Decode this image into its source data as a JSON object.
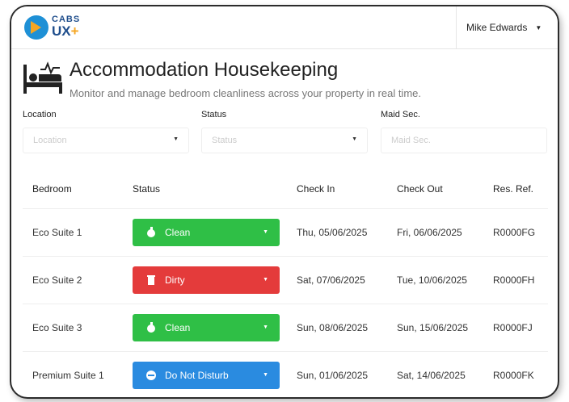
{
  "brand": {
    "top": "CABS",
    "main": "UX",
    "plus": "+"
  },
  "user": {
    "name": "Mike Edwards"
  },
  "page": {
    "title": "Accommodation Housekeeping",
    "subtitle": "Monitor and manage bedroom cleanliness across your property in real time."
  },
  "filters": [
    {
      "label": "Location",
      "placeholder": "Location"
    },
    {
      "label": "Status",
      "placeholder": "Status"
    },
    {
      "label": "Maid Sec.",
      "placeholder": "Maid Sec."
    }
  ],
  "table": {
    "columns": [
      "Bedroom",
      "Status",
      "Check In",
      "Check Out",
      "Res. Ref."
    ],
    "rows": [
      {
        "bedroom": "Eco Suite 1",
        "status": "Clean",
        "check_in": "Thu, 05/06/2025",
        "check_out": "Fri, 06/06/2025",
        "ref": "R0000FG"
      },
      {
        "bedroom": "Eco Suite 2",
        "status": "Dirty",
        "check_in": "Sat, 07/06/2025",
        "check_out": "Tue, 10/06/2025",
        "ref": "R0000FH"
      },
      {
        "bedroom": "Eco Suite 3",
        "status": "Clean",
        "check_in": "Sun, 08/06/2025",
        "check_out": "Sun, 15/06/2025",
        "ref": "R0000FJ"
      },
      {
        "bedroom": "Premium Suite 1",
        "status": "Do Not Disturb",
        "check_in": "Sun, 01/06/2025",
        "check_out": "Sat, 14/06/2025",
        "ref": "R0000FK"
      }
    ]
  },
  "colors": {
    "clean": "#2fbf46",
    "dirty": "#e43b3b",
    "dnd": "#2a8be0",
    "brand_blue": "#1e90d6",
    "brand_orange": "#f5a623"
  },
  "icons": {
    "clean": "broom-icon",
    "dirty": "trash-icon",
    "dnd": "no-entry-icon",
    "header": "bed-icon"
  }
}
